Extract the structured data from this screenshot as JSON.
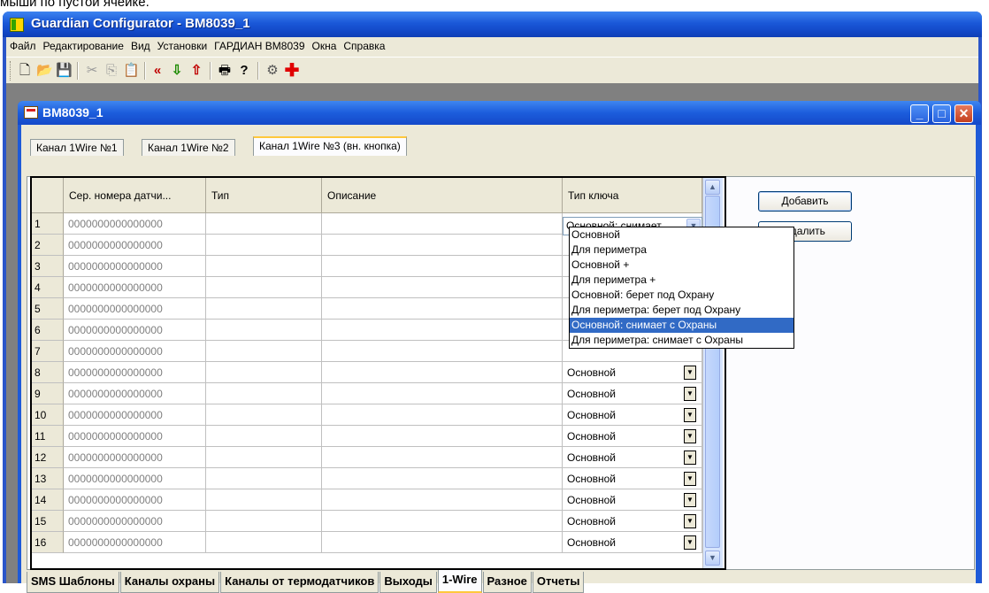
{
  "caption": "мыши по пустой ячейке.",
  "app": {
    "title": "Guardian Configurator - BM8039_1"
  },
  "menu": [
    "Файл",
    "Редактирование",
    "Вид",
    "Установки",
    "ГАРДИАН BM8039",
    "Окна",
    "Справка"
  ],
  "toolbar_icons": [
    "new-file-icon",
    "open-folder-icon",
    "save-icon",
    "cut-icon",
    "copy-icon",
    "paste-icon",
    "read-back-icon",
    "download-icon",
    "upload-icon",
    "print-icon",
    "help-icon",
    "settings-icon",
    "red-cross-icon"
  ],
  "child": {
    "title": "BM8039_1"
  },
  "tabs": [
    "Канал 1Wire №1",
    "Канал 1Wire №2",
    "Канал 1Wire №3 (вн. кнопка)"
  ],
  "active_tab": 2,
  "grid": {
    "headers": [
      "Сер. номера датчи...",
      "Тип",
      "Описание",
      "Тип ключа"
    ],
    "rows": [
      {
        "n": "1",
        "serial": "0000000000000000"
      },
      {
        "n": "2",
        "serial": "0000000000000000"
      },
      {
        "n": "3",
        "serial": "0000000000000000"
      },
      {
        "n": "4",
        "serial": "0000000000000000"
      },
      {
        "n": "5",
        "serial": "0000000000000000"
      },
      {
        "n": "6",
        "serial": "0000000000000000"
      },
      {
        "n": "7",
        "serial": "0000000000000000"
      },
      {
        "n": "8",
        "serial": "0000000000000000",
        "key": "Основной"
      },
      {
        "n": "9",
        "serial": "0000000000000000",
        "key": "Основной"
      },
      {
        "n": "10",
        "serial": "0000000000000000",
        "key": "Основной"
      },
      {
        "n": "11",
        "serial": "0000000000000000",
        "key": "Основной"
      },
      {
        "n": "12",
        "serial": "0000000000000000",
        "key": "Основной"
      },
      {
        "n": "13",
        "serial": "0000000000000000",
        "key": "Основной"
      },
      {
        "n": "14",
        "serial": "0000000000000000",
        "key": "Основной"
      },
      {
        "n": "15",
        "serial": "0000000000000000",
        "key": "Основной"
      },
      {
        "n": "16",
        "serial": "0000000000000000",
        "key": "Основной"
      }
    ],
    "combo_value": "Основной: снимает",
    "dropdown_options": [
      "Основной",
      "Для периметра",
      "Основной +",
      "Для периметра +",
      "Основной: берет под Охрану",
      "Для периметра: берет под Охрану",
      "Основной: снимает с Охраны",
      "Для периметра: снимает с Охраны"
    ],
    "dropdown_selected": 6
  },
  "buttons": {
    "add": "Добавить",
    "delete": "Удалить"
  },
  "bottom_tabs": [
    "SMS Шаблоны",
    "Каналы охраны",
    "Каналы от термодатчиков",
    "Выходы",
    "1-Wire",
    "Разное",
    "Отчеты"
  ],
  "active_bottom_tab": 4
}
